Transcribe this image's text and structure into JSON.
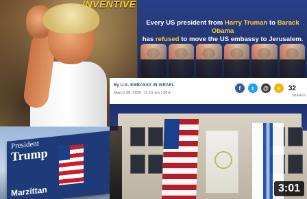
{
  "thumbnail": {
    "duration": "3:01"
  },
  "panels": {
    "portrait": {
      "caption": "INVENTIVE"
    },
    "billboard": {
      "line1": "President",
      "line2": "Trump",
      "bottom_text": "Marzittan"
    },
    "presidents": {
      "headline_parts": {
        "p1": "Every US president from ",
        "truman": "Harry Truman",
        "p2": " to ",
        "obama": "Barack Obama",
        "p3": " has ",
        "refused": "refused",
        "p4": " to move the US embassy to Jerusalem."
      }
    },
    "article": {
      "byline": "By U.S. EMBASSY IN ISRAEL",
      "date_meta": "March 26, 2020, 11:19 am  |  36 ▸",
      "share_count": "32",
      "share_count_label": "SHARES"
    }
  },
  "icons": {
    "facebook": "facebook-icon",
    "twitter": "twitter-icon",
    "email": "email-icon",
    "more": "more-icon"
  },
  "colors": {
    "highlight_yellow": "#f6d33a",
    "navy": "#23356f",
    "facebook": "#3b5998",
    "twitter": "#1da1f2",
    "us_red": "#b51d2a",
    "israel_blue": "#1d4fb3"
  }
}
